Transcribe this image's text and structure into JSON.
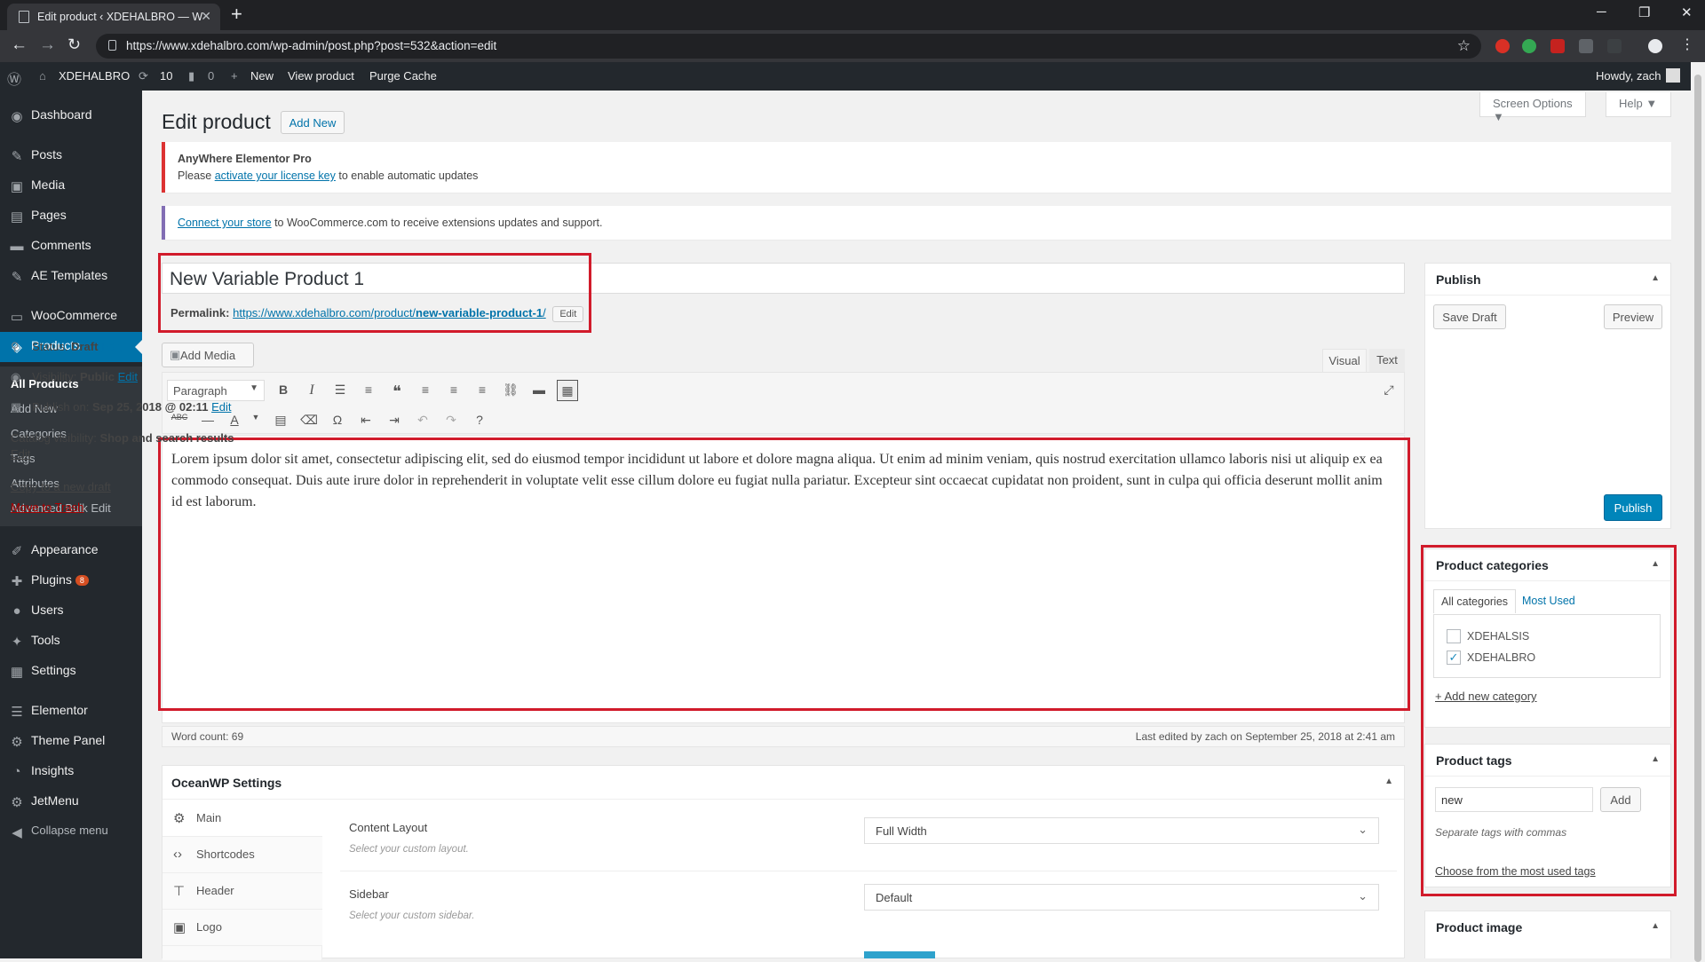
{
  "browser": {
    "tab_title": "Edit product ‹ XDEHALBRO — W",
    "url": "https://www.xdehalbro.com/wp-admin/post.php?post=532&action=edit"
  },
  "adminbar": {
    "site": "XDEHALBRO",
    "updates": "10",
    "comments": "0",
    "new": "New",
    "view": "View product",
    "purge": "Purge Cache",
    "howdy": "Howdy, zach"
  },
  "sidebar": {
    "items": [
      {
        "label": "Dashboard",
        "icon": "dashboard-icon"
      },
      {
        "label": "Posts",
        "icon": "pin-icon"
      },
      {
        "label": "Media",
        "icon": "media-icon"
      },
      {
        "label": "Pages",
        "icon": "pages-icon"
      },
      {
        "label": "Comments",
        "icon": "comments-icon"
      },
      {
        "label": "AE Templates",
        "icon": "pin-icon"
      },
      {
        "label": "WooCommerce",
        "icon": "woocommerce-icon"
      },
      {
        "label": "Products",
        "icon": "products-icon"
      },
      {
        "label": "Appearance",
        "icon": "brush-icon"
      },
      {
        "label": "Plugins",
        "icon": "plugin-icon",
        "badge": "8"
      },
      {
        "label": "Users",
        "icon": "users-icon"
      },
      {
        "label": "Tools",
        "icon": "tools-icon"
      },
      {
        "label": "Settings",
        "icon": "settings-icon"
      },
      {
        "label": "Elementor",
        "icon": "elementor-icon"
      },
      {
        "label": "Theme Panel",
        "icon": "gear-icon"
      },
      {
        "label": "Insights",
        "icon": "insights-icon"
      },
      {
        "label": "JetMenu",
        "icon": "gear-icon"
      },
      {
        "label": "Collapse menu",
        "icon": "collapse-icon"
      }
    ],
    "submenu": [
      "All Products",
      "Add New",
      "Categories",
      "Tags",
      "Attributes",
      "Advanced Bulk Edit"
    ]
  },
  "header": {
    "title": "Edit product",
    "add_new": "Add New",
    "screen_options": "Screen Options ▼",
    "help": "Help ▼"
  },
  "notices": {
    "elementor_title": "AnyWhere Elementor Pro",
    "elementor_pre": "Please ",
    "elementor_link": "activate your license key",
    "elementor_post": " to enable automatic updates",
    "woo_link": "Connect your store",
    "woo_post": " to WooCommerce.com to receive extensions updates and support."
  },
  "post": {
    "title": "New Variable Product 1",
    "permalink_label": "Permalink:",
    "permalink_base": "https://www.xdehalbro.com/product/",
    "permalink_slug": "new-variable-product-1",
    "permalink_end": "/",
    "edit": "Edit"
  },
  "editor": {
    "add_media": "Add Media",
    "visual_tab": "Visual",
    "text_tab": "Text",
    "format": "Paragraph",
    "content": "Lorem ipsum dolor sit amet, consectetur adipiscing elit, sed do eiusmod tempor incididunt ut labore et dolore magna aliqua. Ut enim ad minim veniam, quis nostrud exercitation ullamco laboris nisi ut aliquip ex ea commodo consequat. Duis aute irure dolor in reprehenderit in voluptate velit esse cillum dolore eu fugiat nulla pariatur. Excepteur sint occaecat cupidatat non proident, sunt in culpa qui officia deserunt mollit anim id est laborum.",
    "word_count": "Word count: 69",
    "last_edited": "Last edited by zach on September 25, 2018 at 2:41 am"
  },
  "oceanwp": {
    "title": "OceanWP Settings",
    "tabs": [
      "Main",
      "Shortcodes",
      "Header",
      "Logo"
    ],
    "fields": [
      {
        "label": "Content Layout",
        "desc": "Select your custom layout.",
        "value": "Full Width"
      },
      {
        "label": "Sidebar",
        "desc": "Select your custom sidebar.",
        "value": "Default"
      }
    ]
  },
  "publish": {
    "title": "Publish",
    "save_draft": "Save Draft",
    "preview": "Preview",
    "status_label": "Status: ",
    "status": "Draft",
    "visibility_label": "Visibility: ",
    "visibility": "Public",
    "publish_on_label": "Publish on: ",
    "publish_on": "Sep 25, 2018 @ 02:11",
    "catalog_label": "Catalog visibility: ",
    "catalog": "Shop and search results",
    "edit": "Edit",
    "copy_draft": "Copy to a new draft",
    "trash": "Move to Trash",
    "publish_btn": "Publish"
  },
  "categories": {
    "title": "Product categories",
    "tab_all": "All categories",
    "tab_used": "Most Used",
    "items": [
      {
        "label": "XDEHALSIS",
        "checked": false
      },
      {
        "label": "XDEHALBRO",
        "checked": true
      }
    ],
    "add_new": "+ Add new category"
  },
  "tags": {
    "title": "Product tags",
    "input_value": "new",
    "add": "Add",
    "hint": "Separate tags with commas",
    "choose": "Choose from the most used tags"
  },
  "product_image": {
    "title": "Product image"
  }
}
